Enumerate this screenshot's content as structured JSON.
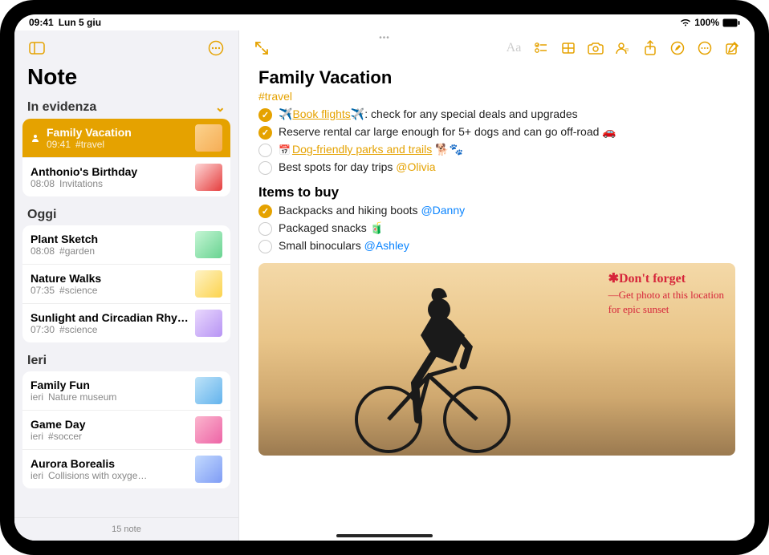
{
  "status": {
    "time": "09:41",
    "date": "Lun 5 giu",
    "battery": "100%"
  },
  "sidebar": {
    "title": "Note",
    "sections": [
      {
        "header": "In evidenza",
        "items": [
          {
            "title": "Family Vacation",
            "time": "09:41",
            "tag": "#travel",
            "shared": true,
            "selected": true
          },
          {
            "title": "Anthonio's Birthday",
            "time": "08:08",
            "tag": "Invitations"
          }
        ]
      },
      {
        "header": "Oggi",
        "items": [
          {
            "title": "Plant Sketch",
            "time": "08:08",
            "tag": "#garden"
          },
          {
            "title": "Nature Walks",
            "time": "07:35",
            "tag": "#science"
          },
          {
            "title": "Sunlight and Circadian Rhy…",
            "time": "07:30",
            "tag": "#science"
          }
        ]
      },
      {
        "header": "Ieri",
        "items": [
          {
            "title": "Family Fun",
            "time": "ieri",
            "tag": "Nature museum"
          },
          {
            "title": "Game Day",
            "time": "ieri",
            "tag": "#soccer"
          },
          {
            "title": "Aurora Borealis",
            "time": "ieri",
            "tag": "Collisions with oxyge…"
          }
        ]
      }
    ],
    "footer": "15 note"
  },
  "note": {
    "title": "Family Vacation",
    "tag": "#travel",
    "checklist1": [
      {
        "checked": true,
        "pre_emoji": "✈️",
        "link": "Book flights",
        "post_emoji": "✈️",
        "rest": ": check for any special deals and upgrades"
      },
      {
        "checked": true,
        "text": "Reserve rental car large enough for 5+ dogs and can go off-road 🚗"
      },
      {
        "checked": false,
        "icon": "📅",
        "link": "Dog-friendly parks and trails",
        "rest": " 🐕🐾"
      },
      {
        "checked": false,
        "text": "Best spots for day trips ",
        "mention": "@Olivia"
      }
    ],
    "subhead": "Items to buy",
    "checklist2": [
      {
        "checked": true,
        "text": "Backpacks and hiking boots ",
        "mention": "@Danny",
        "mention_blue": true
      },
      {
        "checked": false,
        "text": "Packaged snacks 🧃"
      },
      {
        "checked": false,
        "text": "Small binoculars ",
        "mention": "@Ashley",
        "mention_blue": true
      }
    ],
    "handwriting": {
      "title": "✱Don't forget",
      "line1": "—Get photo at this location",
      "line2": "for epic sunset"
    }
  }
}
